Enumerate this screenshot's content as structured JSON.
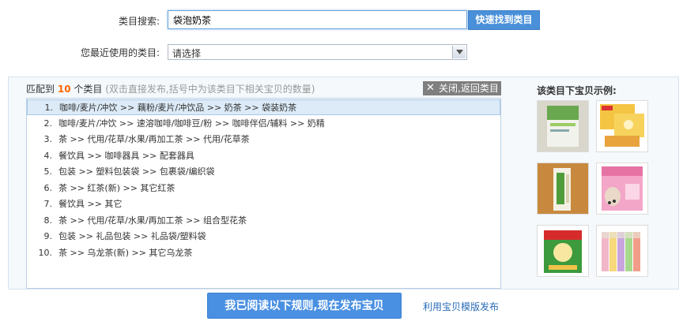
{
  "search": {
    "label": "类目搜索:",
    "value": "袋泡奶茶",
    "button": "快速找到类目"
  },
  "recent": {
    "label": "您最近使用的类目:",
    "selected": "请选择"
  },
  "results": {
    "prefix": "匹配到",
    "count": "10",
    "suffix": "个类目",
    "hint": "(双击直接发布,括号中为该类目下相关宝贝的数量)",
    "close_label": "关闭,返回类目",
    "items": [
      {
        "num": "1.",
        "text": "咖啡/麦片/冲饮 >> 藕粉/麦片/冲饮品 >> 奶茶 >> 袋装奶茶"
      },
      {
        "num": "2.",
        "text": "咖啡/麦片/冲饮 >> 速溶咖啡/咖啡豆/粉 >> 咖啡伴侣/辅料 >> 奶精"
      },
      {
        "num": "3.",
        "text": "茶 >> 代用/花草/水果/再加工茶 >> 代用/花草茶"
      },
      {
        "num": "4.",
        "text": "餐饮具 >> 咖啡器具 >> 配套器具"
      },
      {
        "num": "5.",
        "text": "包装 >> 塑料包装袋 >> 包裹袋/编织袋"
      },
      {
        "num": "6.",
        "text": "茶 >> 红茶(新) >> 其它红茶"
      },
      {
        "num": "7.",
        "text": "餐饮具 >> 其它"
      },
      {
        "num": "8.",
        "text": "茶 >> 代用/花草/水果/再加工茶 >> 组合型花茶"
      },
      {
        "num": "9.",
        "text": "包装 >> 礼品包装 >> 礼品袋/塑料袋"
      },
      {
        "num": "10.",
        "text": "茶 >> 乌龙茶(新) >> 其它乌龙茶"
      }
    ]
  },
  "examples": {
    "title": "该类目下宝贝示例:",
    "thumbs": [
      {
        "name": "thumb-green-pouch"
      },
      {
        "name": "thumb-yellow-box"
      },
      {
        "name": "thumb-stick-pack"
      },
      {
        "name": "thumb-pink-milktea-box"
      },
      {
        "name": "thumb-green-red-bag"
      },
      {
        "name": "thumb-colorful-sticks"
      }
    ]
  },
  "footer": {
    "publish_label": "我已阅读以下规则,现在发布宝贝",
    "template_link": "利用宝贝模版发布"
  }
}
